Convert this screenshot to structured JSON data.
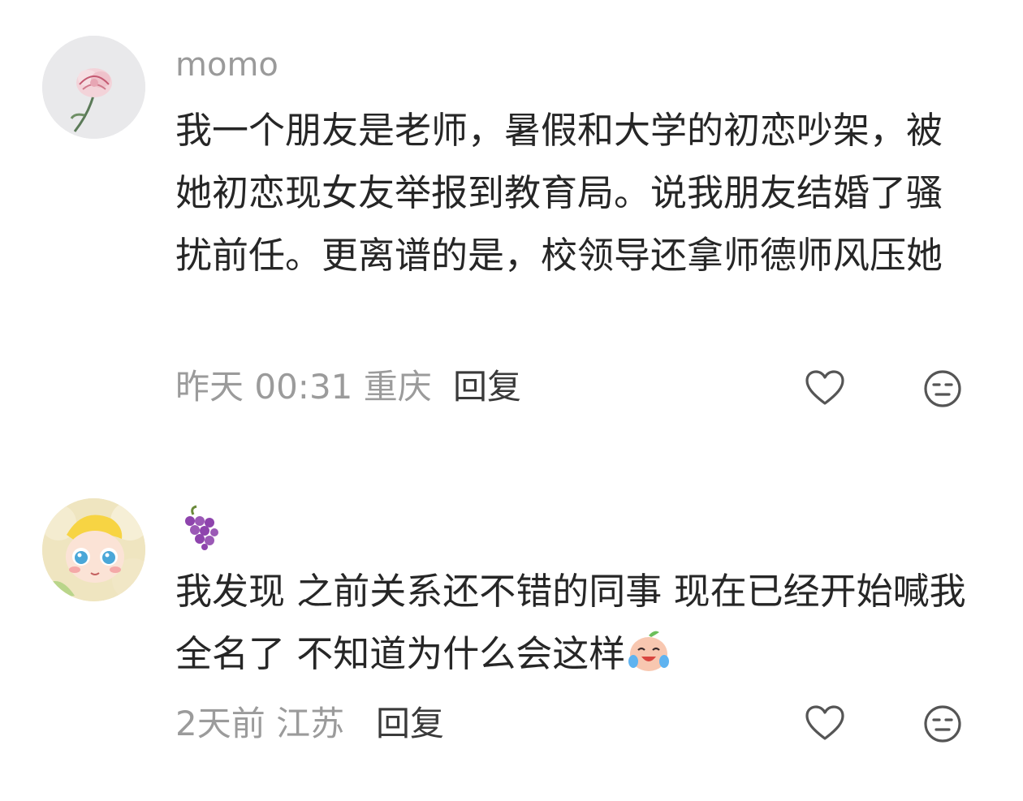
{
  "comments": [
    {
      "username": "momo",
      "avatar_icon": "carnation-flower-avatar",
      "text": "我一个朋友是老师，暑假和大学的初恋吵架，被她初恋现女友举报到教育局。说我朋友结婚了骚扰前任。更离谱的是，校领导还拿师德师风压她",
      "time": "昨天 00:31",
      "location": "重庆",
      "reply_label": "回复",
      "like_icon": "heart-outline-icon",
      "dislike_icon": "meh-face-icon"
    },
    {
      "username_icon": "grapes-emoji",
      "avatar_icon": "cartoon-doll-avatar",
      "text": "我发现 之前关系还不错的同事 现在已经开始喊我全名了 不知道为什么会这样",
      "trailing_emoji": "crying-laughing-peach-emoji",
      "time": "2天前",
      "location": "江苏",
      "reply_label": "回复",
      "like_icon": "heart-outline-icon",
      "dislike_icon": "meh-face-icon"
    }
  ],
  "colors": {
    "meta_text": "#9b9b9b",
    "body_text": "#262626",
    "username_text": "#9a9a9a",
    "icon_stroke": "#555555"
  }
}
